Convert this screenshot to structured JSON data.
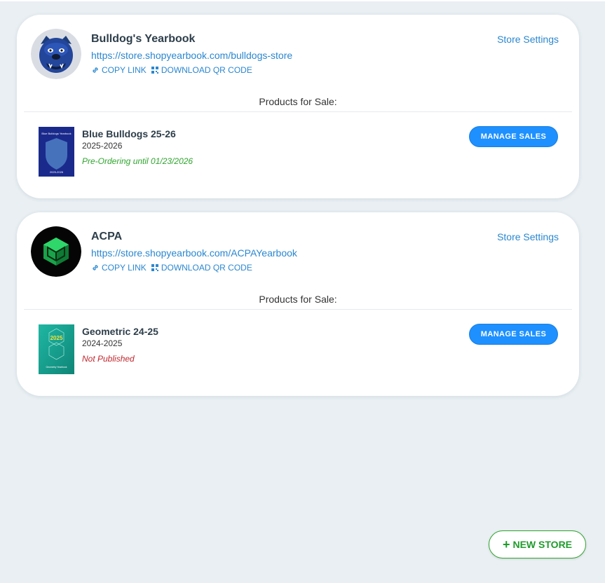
{
  "stores": [
    {
      "name": "Bulldog's Yearbook",
      "url": "https://store.shopyearbook.com/bulldogs-store",
      "copy_link": "COPY LINK",
      "download_qr": "DOWNLOAD QR CODE",
      "settings": "Store Settings",
      "section_title": "Products for Sale:",
      "logo_icon": "bulldog-mascot-icon",
      "product": {
        "name": "Blue Bulldogs 25-26",
        "years": "2025-2026",
        "status": "Pre-Ordering until 01/23/2026",
        "status_color": "#2fa52f",
        "button": "MANAGE SALES",
        "cover_title": "Blue Bulldogs Yearbook",
        "cover_years": "2025-2026"
      }
    },
    {
      "name": "ACPA",
      "url": "https://store.shopyearbook.com/ACPAYearbook",
      "copy_link": "COPY LINK",
      "download_qr": "DOWNLOAD QR CODE",
      "settings": "Store Settings",
      "section_title": "Products for Sale:",
      "logo_icon": "green-cube-icon",
      "product": {
        "name": "Geometric 24-25",
        "years": "2024-2025",
        "status": "Not Published",
        "status_color": "#c0272d",
        "button": "MANAGE SALES",
        "cover_title": "2025",
        "cover_subtitle": "Geometry Yearbook"
      }
    }
  ],
  "new_store": {
    "label": "NEW STORE",
    "icon": "plus-icon"
  },
  "colors": {
    "background": "#e9eff3",
    "link": "#2a87d0",
    "primary_button": "#1e90ff",
    "success": "#2fa52f"
  }
}
